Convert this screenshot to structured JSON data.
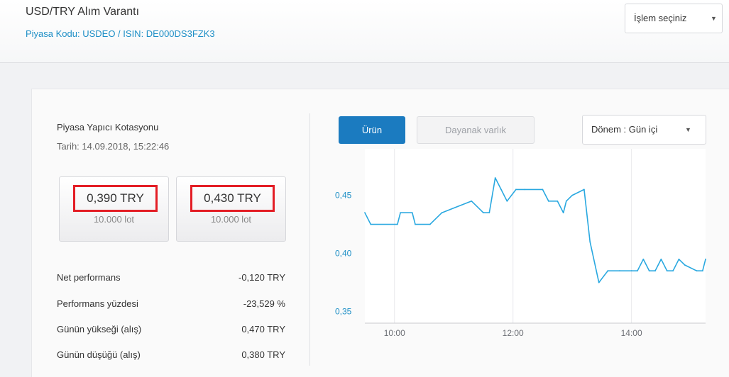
{
  "header": {
    "title": "USD/TRY Alım Varantı",
    "subtitle": "Piyasa Kodu: USDEO / ISIN: DE000DS3FZK3",
    "action_select": "İşlem seçiniz"
  },
  "quote": {
    "heading": "Piyasa Yapıcı Kotasyonu",
    "date": "Tarih: 14.09.2018, 15:22:46",
    "bid": {
      "price": "0,390 TRY",
      "lot": "10.000 lot"
    },
    "ask": {
      "price": "0,430 TRY",
      "lot": "10.000 lot"
    }
  },
  "stats": [
    {
      "label": "Net performans",
      "value": "-0,120 TRY"
    },
    {
      "label": "Performans yüzdesi",
      "value": "-23,529 %"
    },
    {
      "label": "Günün yükseği (alış)",
      "value": "0,470 TRY"
    },
    {
      "label": "Günün düşüğü (alış)",
      "value": "0,380 TRY"
    }
  ],
  "chart_controls": {
    "tab_product": "Ürün",
    "tab_underlying": "Dayanak varlık",
    "period_select": "Dönem : Gün içi"
  },
  "colors": {
    "accent": "#1b7bc0",
    "highlight": "#e31d25",
    "line": "#29a8e0",
    "link": "#1e8fc6"
  },
  "icons": {
    "dropdown": "caret-down-icon"
  },
  "chart_data": {
    "type": "line",
    "title": "",
    "xlabel": "",
    "ylabel": "",
    "ylim": [
      0.34,
      0.49
    ],
    "xlim": [
      9.5,
      15.25
    ],
    "x_ticks": [
      10,
      12,
      14
    ],
    "x_tick_labels": [
      "10:00",
      "12:00",
      "14:00"
    ],
    "y_ticks": [
      0.35,
      0.4,
      0.45
    ],
    "y_tick_labels": [
      "0,35",
      "0,40",
      "0,45"
    ],
    "grid": "vertical",
    "legend": false,
    "series": [
      {
        "x": [
          9.5,
          9.6,
          10.05,
          10.1,
          10.3,
          10.35,
          10.6,
          10.8,
          11.3,
          11.5,
          11.6,
          11.7,
          11.8,
          11.9,
          12.05,
          12.2,
          12.5,
          12.6,
          12.75,
          12.85,
          12.9,
          13.0,
          13.2,
          13.3,
          13.45,
          13.6,
          13.8,
          14.0,
          14.1,
          14.2,
          14.3,
          14.4,
          14.5,
          14.6,
          14.7,
          14.8,
          14.9,
          15.1,
          15.2,
          15.25
        ],
        "values": [
          0.435,
          0.425,
          0.425,
          0.435,
          0.435,
          0.425,
          0.425,
          0.435,
          0.445,
          0.435,
          0.435,
          0.465,
          0.455,
          0.445,
          0.455,
          0.455,
          0.455,
          0.445,
          0.445,
          0.435,
          0.445,
          0.45,
          0.455,
          0.41,
          0.375,
          0.385,
          0.385,
          0.385,
          0.385,
          0.395,
          0.385,
          0.385,
          0.395,
          0.385,
          0.385,
          0.395,
          0.39,
          0.385,
          0.385,
          0.395
        ]
      }
    ]
  }
}
